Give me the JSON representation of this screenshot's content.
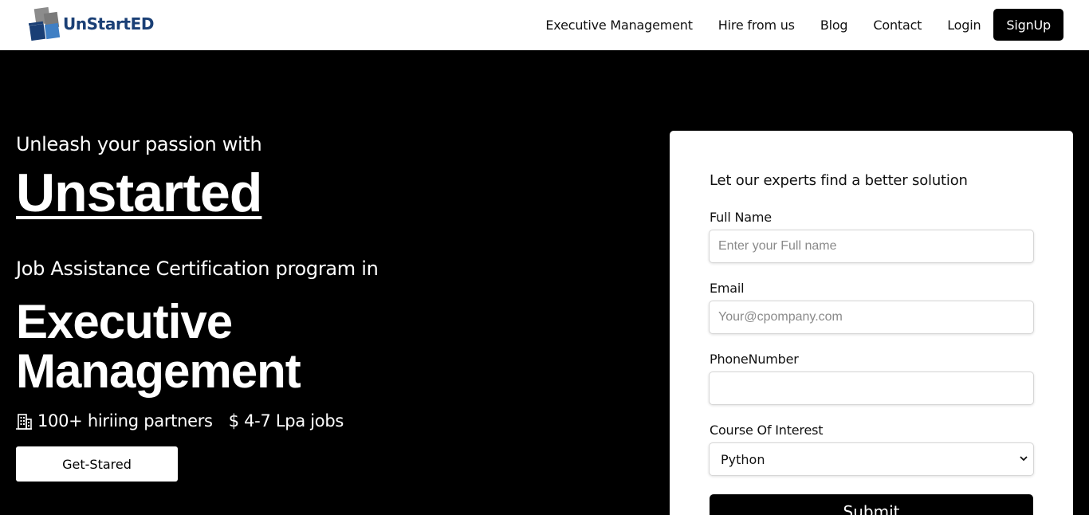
{
  "nav": {
    "logo_text": "UnStartED",
    "links": [
      "Executive Management",
      "Hire from us",
      "Blog",
      "Contact",
      "Login"
    ],
    "signup": "SignUp"
  },
  "hero": {
    "tagline": "Unleash your passion with",
    "brand": "Unstarted",
    "program": "Job Assistance Certification program in",
    "headline_line1": "Executive",
    "headline_line2": "Management",
    "partners": "100+ hiriing partners",
    "jobs": "$ 4-7 Lpa jobs",
    "cta": "Get-Stared"
  },
  "form": {
    "heading": "Let our experts find a better solution",
    "full_name_label": "Full Name",
    "full_name_placeholder": "Enter your Full name",
    "email_label": "Email",
    "email_placeholder": "Your@cpompany.com",
    "phone_label": "PhoneNumber",
    "phone_placeholder": "",
    "course_label": "Course Of Interest",
    "course_value": "Python",
    "submit": "Submit"
  },
  "colors": {
    "brand_blue": "#1a3f75",
    "logo_light_blue": "#3f7fc4",
    "logo_gray": "#8c8c8c"
  }
}
